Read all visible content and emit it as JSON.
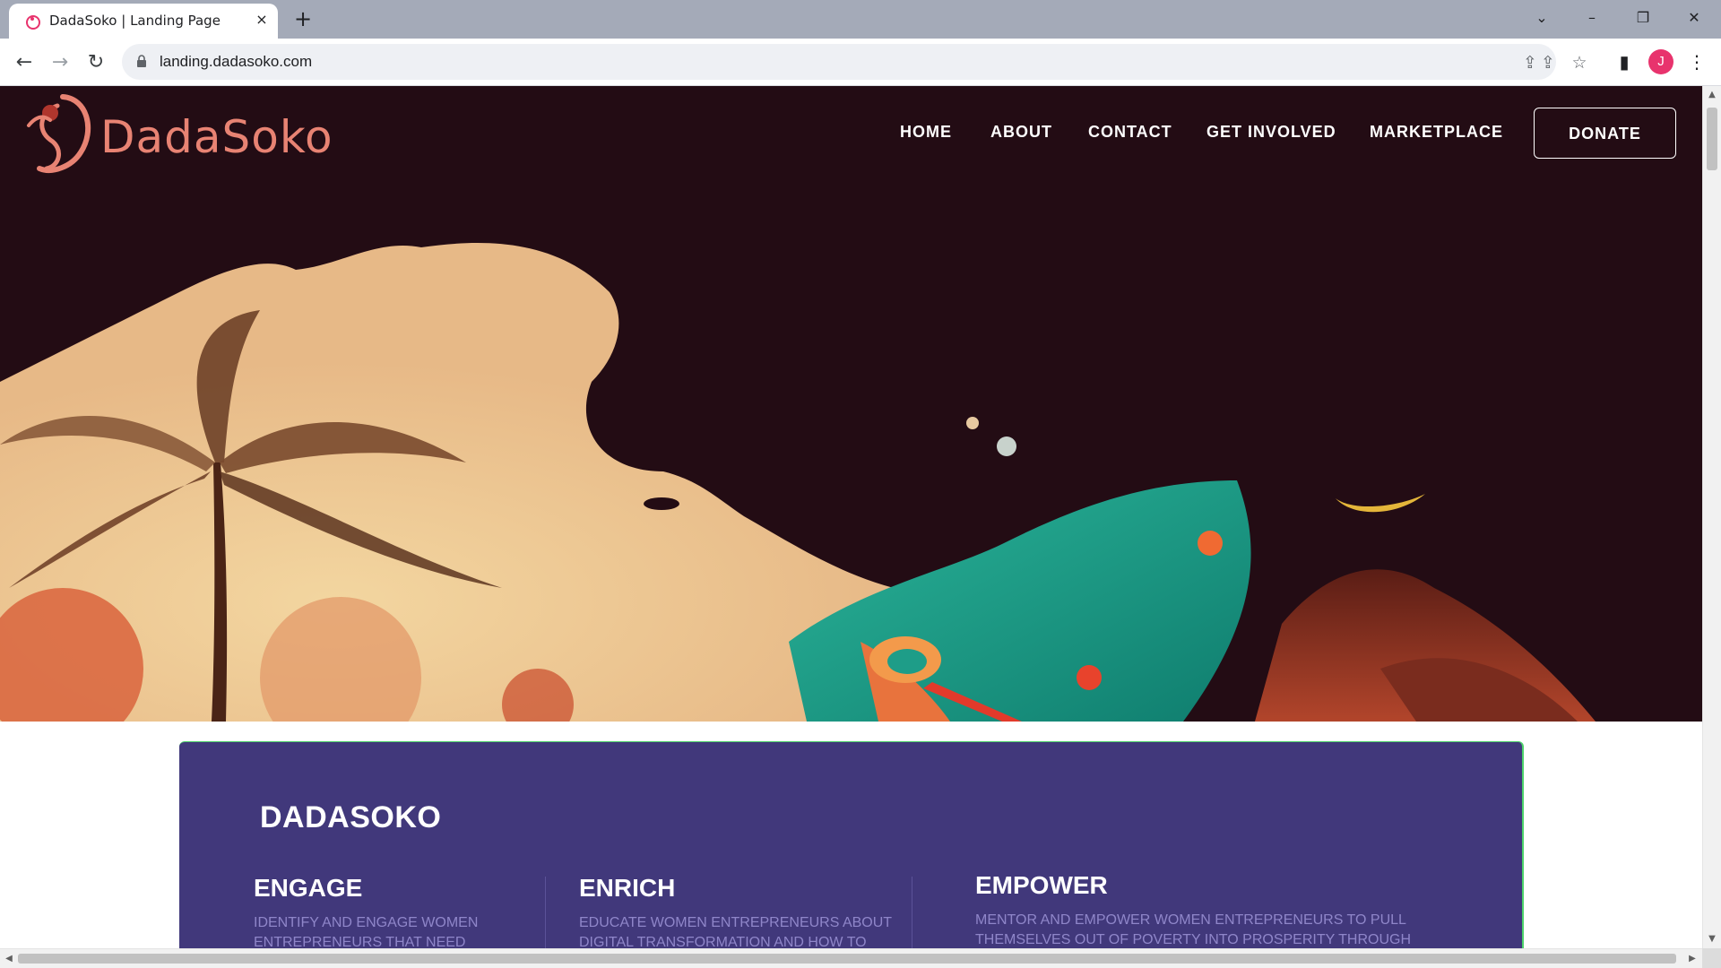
{
  "browser": {
    "tab_title": "DadaSoko | Landing Page",
    "url": "landing.dadasoko.com",
    "profile_initial": "J",
    "icons": {
      "tab_close": "×",
      "new_tab": "+",
      "tab_search": "⌄",
      "minimize": "–",
      "restore": "❐",
      "close": "✕",
      "back": "←",
      "forward": "→",
      "reload": "↻",
      "share": "⇪",
      "bookmark": "☆",
      "side_panel": "▮",
      "menu": "⋮"
    }
  },
  "site": {
    "logo_text": "DadaSoko",
    "nav": [
      "HOME",
      "ABOUT",
      "CONTACT",
      "GET INVOLVED",
      "MARKETPLACE"
    ],
    "donate_label": "DONATE"
  },
  "section": {
    "title": "DADASOKO",
    "columns": [
      {
        "heading": "ENGAGE",
        "text": "IDENTIFY AND ENGAGE WOMEN ENTREPRENEURS THAT NEED"
      },
      {
        "heading": "ENRICH",
        "text": "EDUCATE WOMEN ENTREPRENEURS ABOUT DIGITAL TRANSFORMATION AND HOW TO"
      },
      {
        "heading": "EMPOWER",
        "text": "MENTOR AND EMPOWER WOMEN ENTREPRENEURS TO PULL THEMSELVES OUT OF POVERTY INTO PROSPERITY THROUGH"
      }
    ]
  },
  "colors": {
    "hero_bg": "#230c14",
    "brand_coral": "#e88373",
    "card_bg": "#41387b",
    "card_text": "#8f86c9",
    "accent_green": "#4dd26b"
  }
}
